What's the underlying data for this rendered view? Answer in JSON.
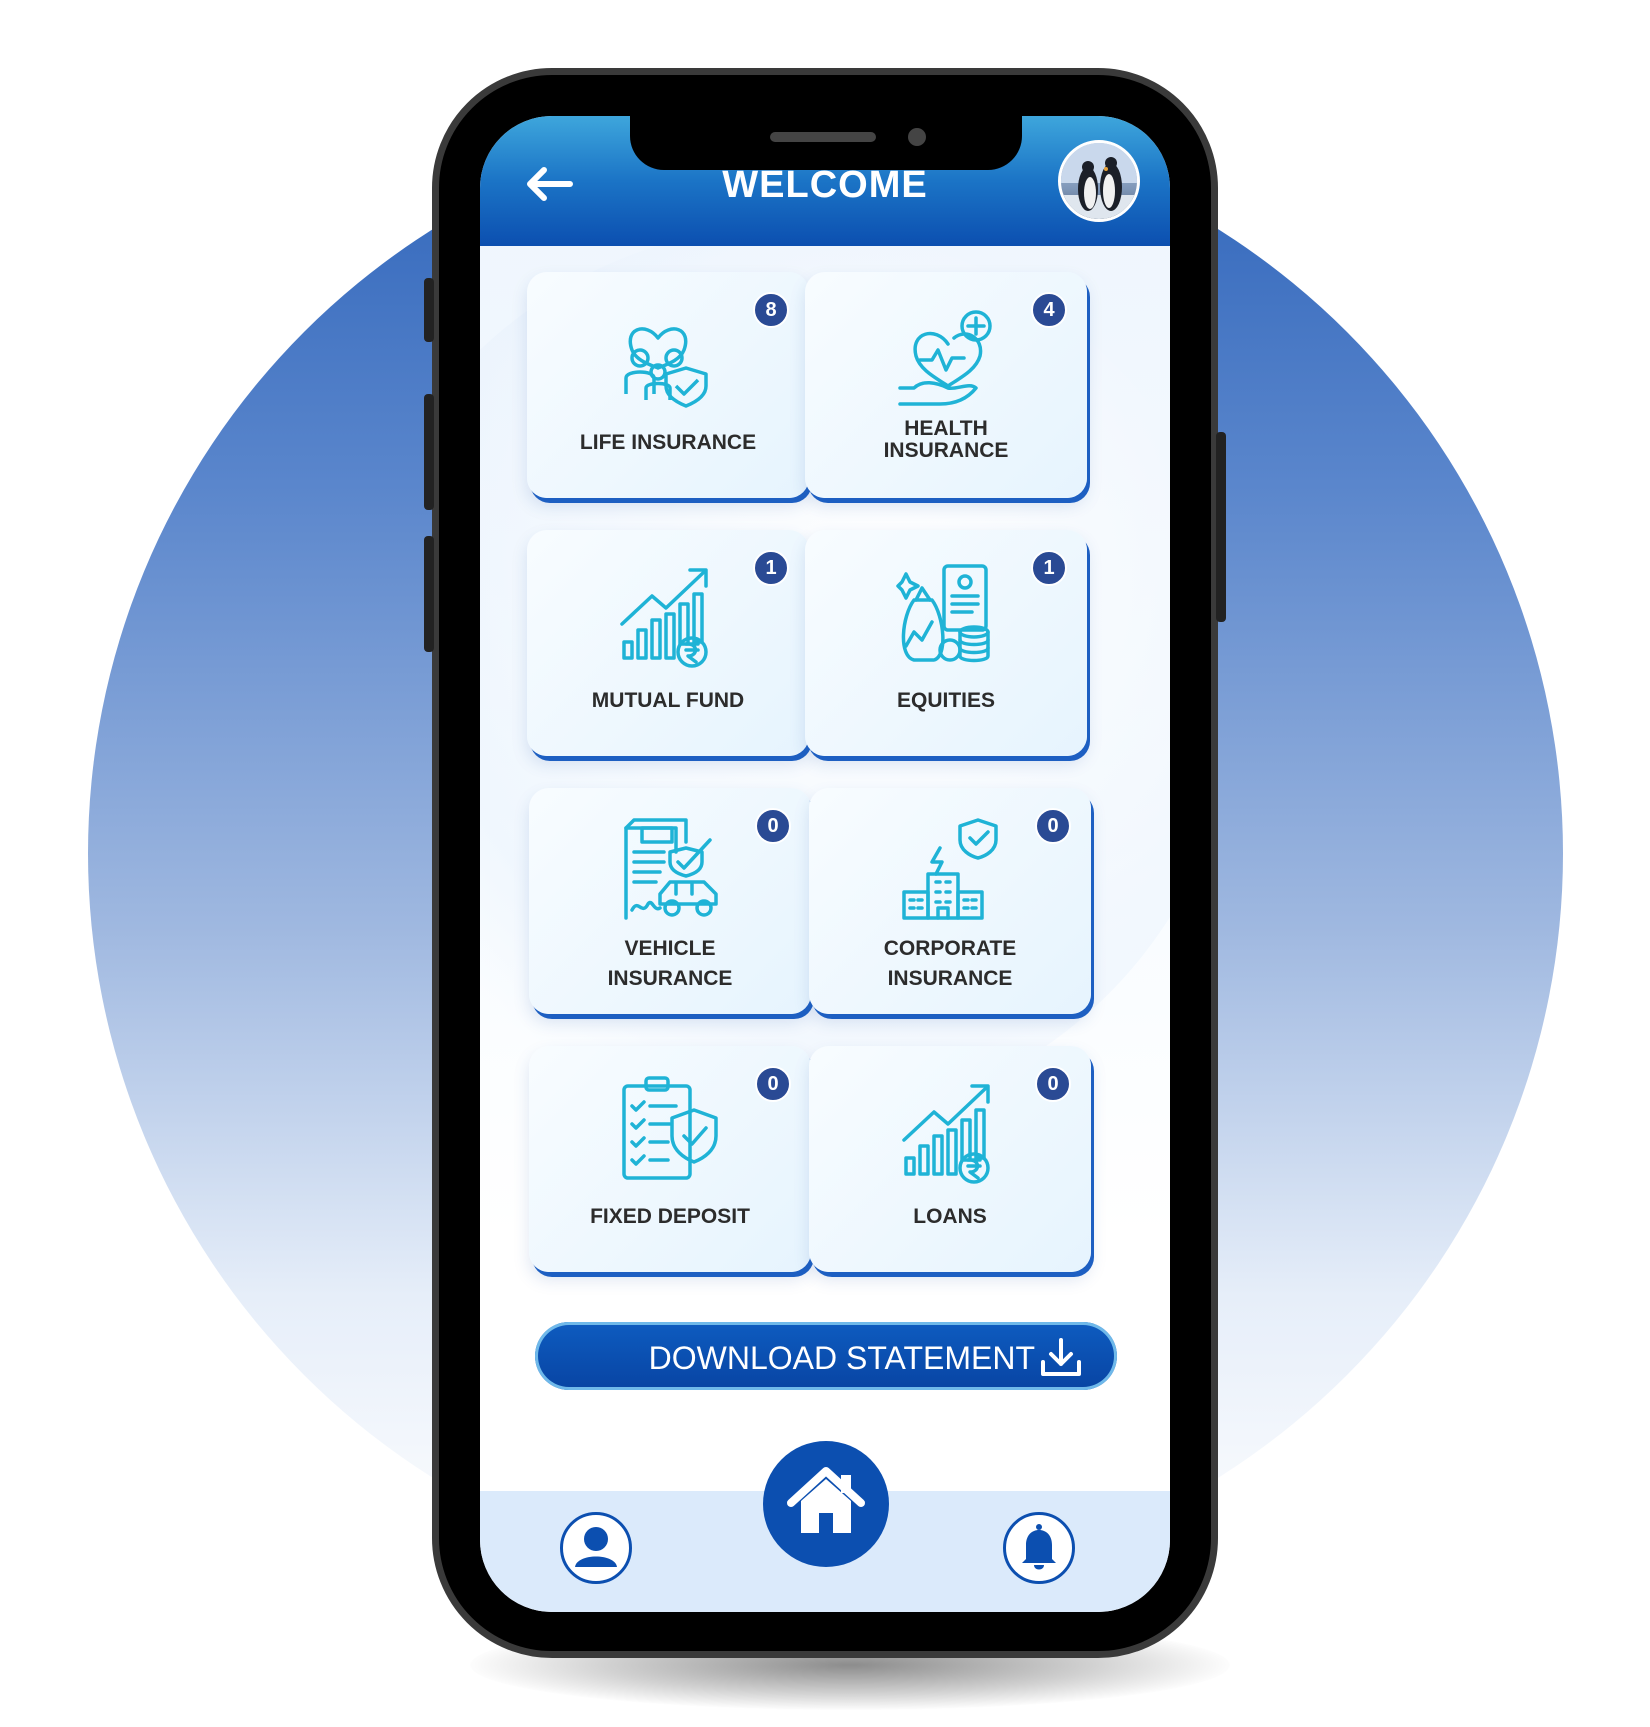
{
  "header": {
    "title": "WELCOME"
  },
  "cards": [
    {
      "label_lines": [
        "LIFE INSURANCE"
      ],
      "count": "8",
      "icon": "family-shield-icon"
    },
    {
      "label_lines": [
        "HEALTH",
        "INSURANCE"
      ],
      "count": "4",
      "icon": "heart-hand-icon"
    },
    {
      "label_lines": [
        "MUTUAL FUND"
      ],
      "count": "1",
      "icon": "growth-rupee-icon"
    },
    {
      "label_lines": [
        "EQUITIES"
      ],
      "count": "1",
      "icon": "equities-icon"
    },
    {
      "label_lines": [
        "VEHICLE",
        "INSURANCE"
      ],
      "count": "0",
      "icon": "car-document-icon"
    },
    {
      "label_lines": [
        "CORPORATE",
        "INSURANCE"
      ],
      "count": "0",
      "icon": "building-shield-icon"
    },
    {
      "label_lines": [
        "FIXED DEPOSIT"
      ],
      "count": "0",
      "icon": "checklist-shield-icon"
    },
    {
      "label_lines": [
        "LOANS"
      ],
      "count": "0",
      "icon": "growth-rupee-icon"
    }
  ],
  "download": {
    "label": "DOWNLOAD STATEMENT",
    "icon": "download-icon"
  },
  "nav": {
    "left": "profile-icon",
    "center": "home-icon",
    "right": "bell-icon"
  },
  "colors": {
    "primary": "#0c4fb0",
    "accent": "#1fb3d6",
    "badge": "#2a4a94"
  }
}
